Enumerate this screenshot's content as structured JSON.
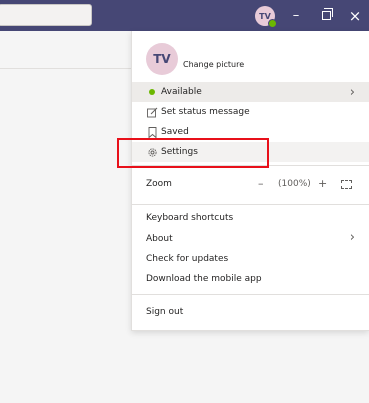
{
  "titlebar": {
    "avatar_initials": "TV",
    "presence_color": "#6bb700",
    "bar_color": "#464775",
    "minimize_glyph": "–",
    "close_glyph": "×"
  },
  "menu": {
    "profile": {
      "initials": "TV",
      "change_picture_label": "Change picture"
    },
    "status": {
      "label": "Available",
      "chevron": "›"
    },
    "set_status_label": "Set status message",
    "saved_label": "Saved",
    "settings_label": "Settings",
    "zoom": {
      "label": "Zoom",
      "minus": "–",
      "level": "(100%)",
      "plus": "+"
    },
    "keyboard_shortcuts_label": "Keyboard shortcuts",
    "about_label": "About",
    "about_chevron": "›",
    "check_updates_label": "Check for updates",
    "download_app_label": "Download the mobile app",
    "sign_out_label": "Sign out"
  },
  "icons": {
    "set_status": "edit-status-icon",
    "saved": "bookmark-icon",
    "settings": "gear-icon",
    "fullscreen": "fullscreen-icon"
  },
  "highlight_color": "#e8101a"
}
